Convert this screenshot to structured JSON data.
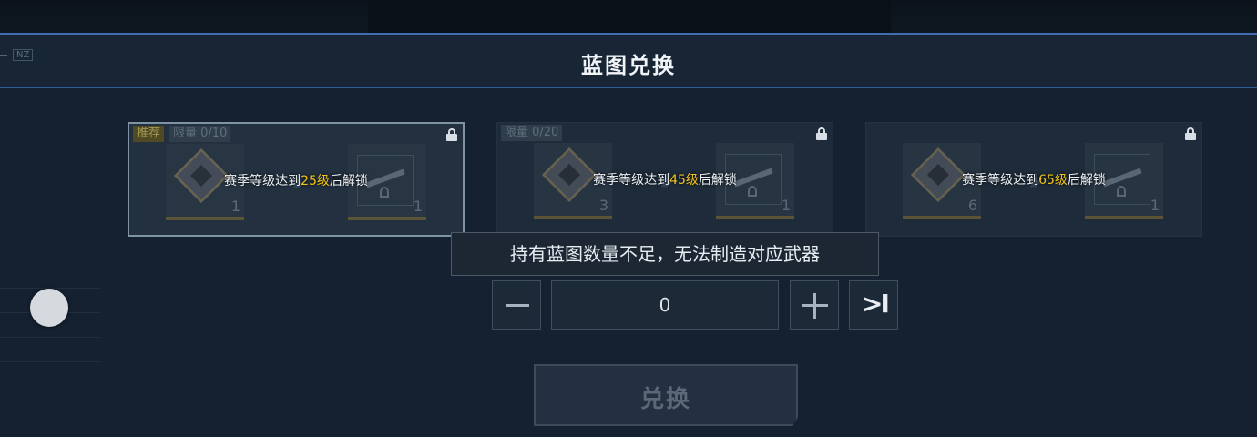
{
  "header": {
    "title": "蓝图兑换",
    "left_tag": "NZ"
  },
  "cards": [
    {
      "badges": [
        "推荐",
        "限量 0/10"
      ],
      "selected": true,
      "input_count": "1",
      "output_count": "1",
      "unlock_prefix": "赛季等级达到",
      "unlock_level": "25级",
      "unlock_suffix": "后解锁"
    },
    {
      "badges": [
        "限量 0/20"
      ],
      "selected": false,
      "input_count": "3",
      "output_count": "1",
      "unlock_prefix": "赛季等级达到",
      "unlock_level": "45级",
      "unlock_suffix": "后解锁"
    },
    {
      "badges": [],
      "selected": false,
      "input_count": "6",
      "output_count": "1",
      "unlock_prefix": "赛季等级达到",
      "unlock_level": "65级",
      "unlock_suffix": "后解锁"
    }
  ],
  "tooltip": "持有蓝图数量不足，无法制造对应武器",
  "quantity": {
    "value": "0",
    "max_label": ">I"
  },
  "exchange_button": {
    "label": "兑换"
  },
  "colors": {
    "accent_blue": "#3f6fb0",
    "level_highlight": "#f0c419",
    "background": "#152131"
  },
  "icons": [
    "lock-icon",
    "blueprint-cube-icon",
    "weapon-blueprint-icon",
    "minus-icon",
    "plus-icon",
    "max-icon",
    "joystick"
  ]
}
